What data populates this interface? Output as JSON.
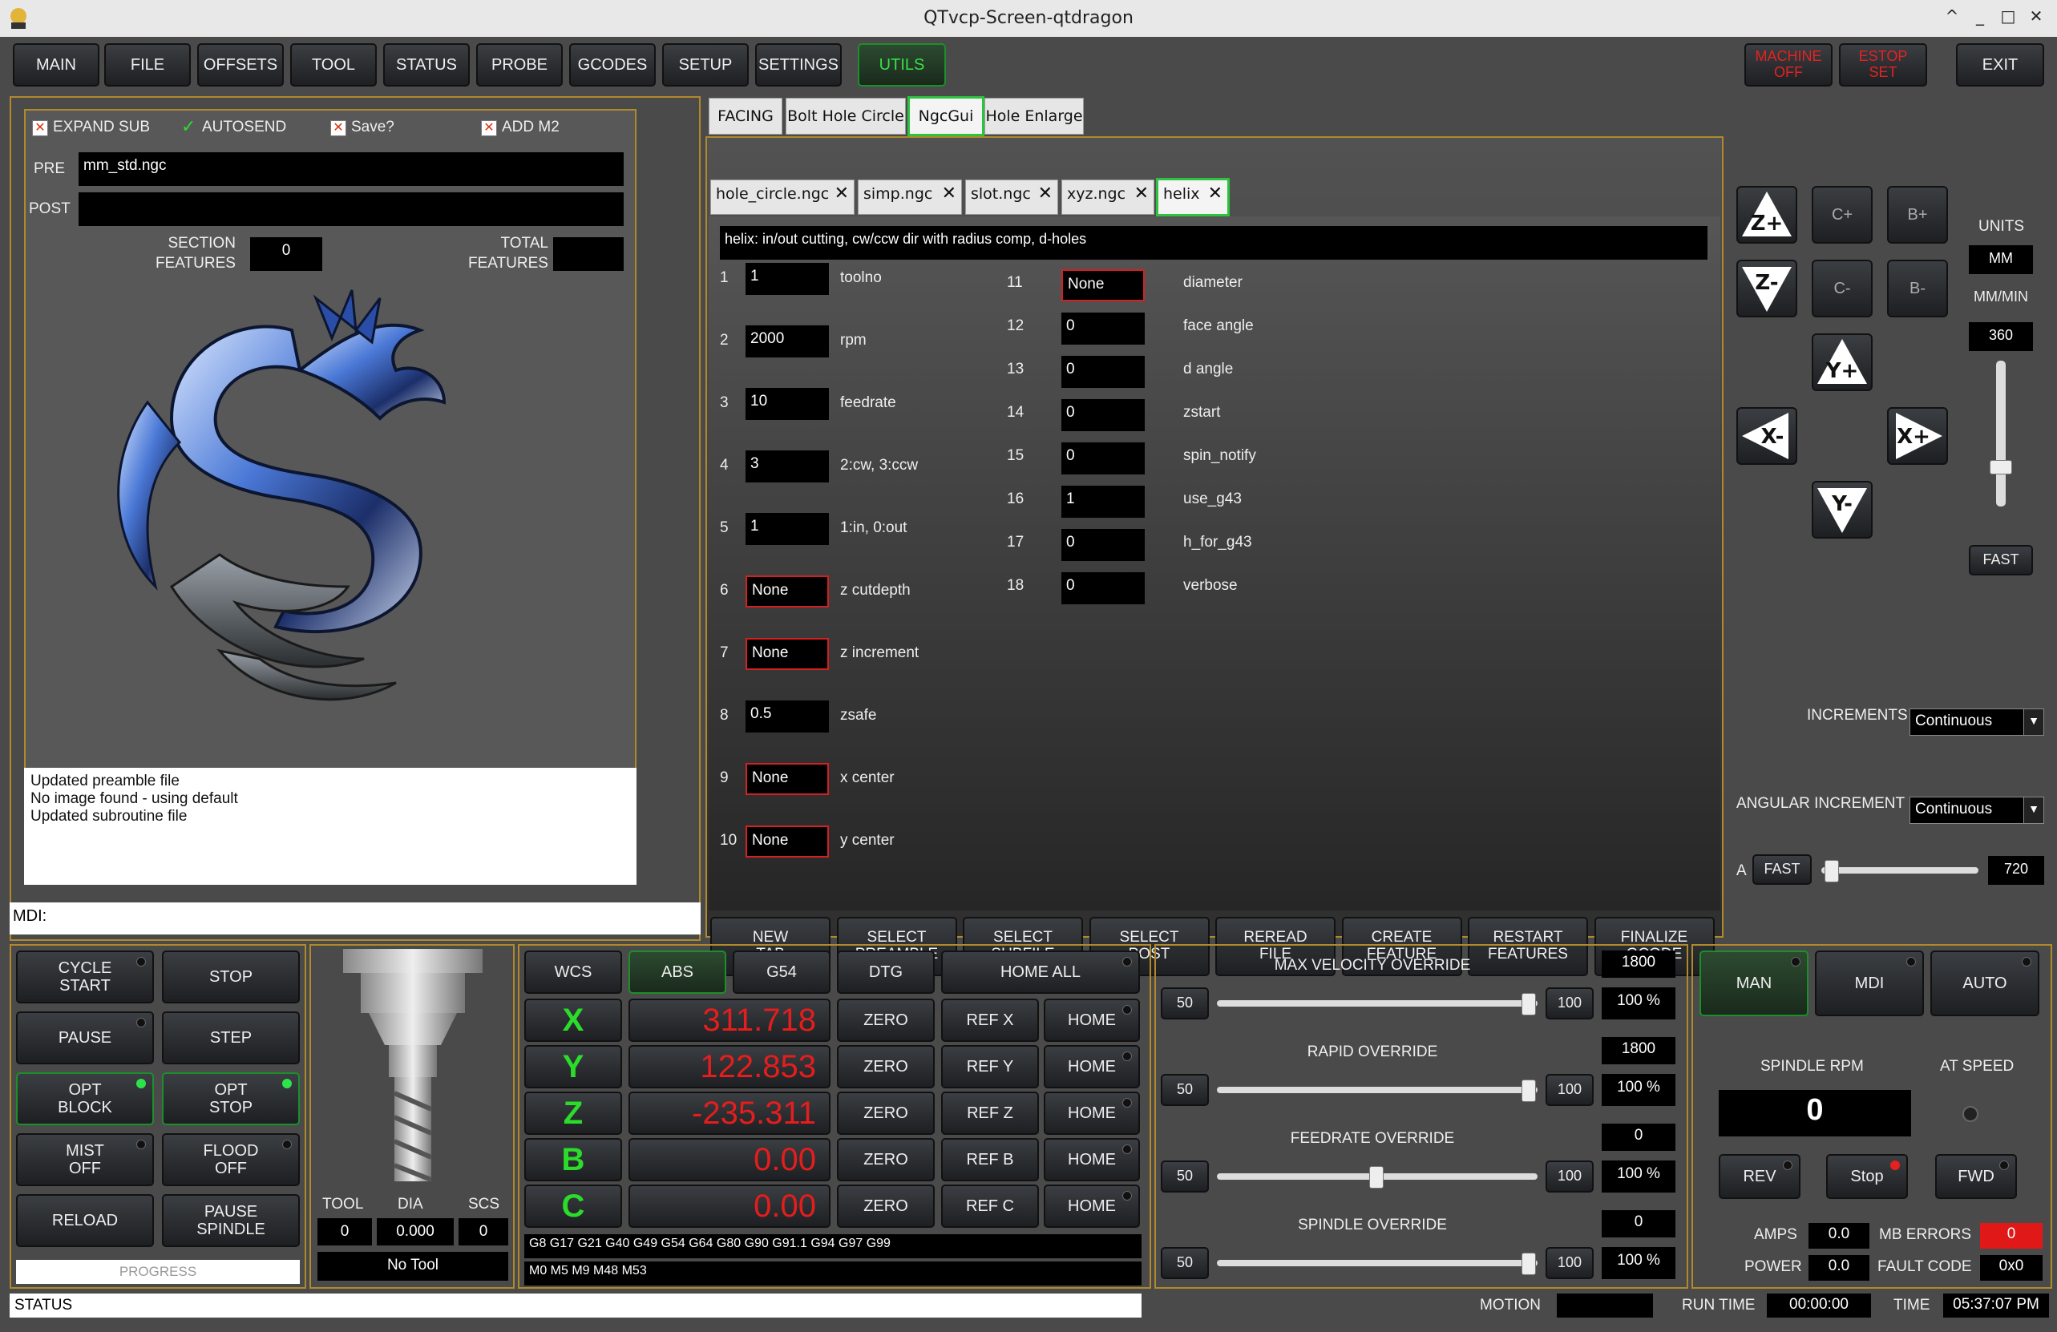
{
  "window": {
    "title": "QTvcp-Screen-qtdragon",
    "controls": [
      "^",
      "_",
      "□",
      "✕"
    ]
  },
  "topbar": {
    "tabs": [
      "MAIN",
      "FILE",
      "OFFSETS",
      "TOOL",
      "STATUS",
      "PROBE",
      "GCODES",
      "SETUP",
      "SETTINGS",
      "UTILS"
    ],
    "active_tab": "UTILS",
    "machine": "MACHINE\nOFF",
    "estop": "ESTOP\nSET",
    "exit": "EXIT"
  },
  "ngc_panel": {
    "expand_sub": "EXPAND SUB",
    "autosend": "AUTOSEND",
    "save": "Save?",
    "add_m2": "ADD M2",
    "pre_label": "PRE",
    "pre_value": "mm_std.ngc",
    "post_label": "POST",
    "post_value": "",
    "section_features_label": "SECTION\nFEATURES",
    "section_features_value": "0",
    "total_features_label": "TOTAL\nFEATURES",
    "total_features_value": "",
    "log": [
      "Updated preamble file",
      "No image found - using default",
      "Updated subroutine file"
    ],
    "mdi_label": "MDI:"
  },
  "utils_tabs": [
    "FACING",
    "Bolt Hole Circle",
    "NgcGui",
    "Hole Enlarge"
  ],
  "utils_active": "NgcGui",
  "file_tabs": [
    "hole_circle.ngc",
    "simp.ngc",
    "slot.ngc",
    "xyz.ngc",
    "helix"
  ],
  "file_active": "helix",
  "helix": {
    "description": "helix: in/out cutting, cw/ccw dir with radius comp, d-holes",
    "params_left": [
      {
        "n": "1",
        "value": "1",
        "label": "toolno",
        "invalid": false
      },
      {
        "n": "2",
        "value": "2000",
        "label": "rpm",
        "invalid": false
      },
      {
        "n": "3",
        "value": "10",
        "label": "feedrate",
        "invalid": false
      },
      {
        "n": "4",
        "value": "3",
        "label": "2:cw, 3:ccw",
        "invalid": false
      },
      {
        "n": "5",
        "value": "1",
        "label": "1:in, 0:out",
        "invalid": false
      },
      {
        "n": "6",
        "value": "None",
        "label": "z cutdepth",
        "invalid": true
      },
      {
        "n": "7",
        "value": "None",
        "label": "z increment",
        "invalid": true
      },
      {
        "n": "8",
        "value": "0.5",
        "label": "zsafe",
        "invalid": false
      },
      {
        "n": "9",
        "value": "None",
        "label": "x center",
        "invalid": true
      },
      {
        "n": "10",
        "value": "None",
        "label": "y center",
        "invalid": true
      }
    ],
    "params_right": [
      {
        "n": "11",
        "value": "None",
        "label": "diameter",
        "invalid": true
      },
      {
        "n": "12",
        "value": "0",
        "label": "face angle",
        "invalid": false
      },
      {
        "n": "13",
        "value": "0",
        "label": "d angle",
        "invalid": false
      },
      {
        "n": "14",
        "value": "0",
        "label": "zstart",
        "invalid": false
      },
      {
        "n": "15",
        "value": "0",
        "label": "spin_notify",
        "invalid": false
      },
      {
        "n": "16",
        "value": "1",
        "label": "use_g43",
        "invalid": false
      },
      {
        "n": "17",
        "value": "0",
        "label": "h_for_g43",
        "invalid": false
      },
      {
        "n": "18",
        "value": "0",
        "label": "verbose",
        "invalid": false
      }
    ]
  },
  "ngc_buttons": [
    "NEW\nTAB",
    "SELECT\nPREAMBLE",
    "SELECT\nSUBFILE",
    "SELECT\nPOST",
    "REREAD\nFILE",
    "CREATE\nFEATURE",
    "RESTART\nFEATURES",
    "FINALIZE\nGCODE"
  ],
  "jog": {
    "buttons": {
      "zplus": "Z+",
      "zminus": "Z-",
      "cplus": "C+",
      "cminus": "C-",
      "bplus": "B+",
      "bminus": "B-",
      "yplus": "Y+",
      "yminus": "Y-",
      "xminus": "X-",
      "xplus": "X+"
    },
    "units_label": "UNITS",
    "units_value": "MM",
    "rate_label": "MM/MIN",
    "rate_value": "360",
    "fast": "FAST",
    "increments_label": "INCREMENTS",
    "increments_value": "Continuous",
    "angular_label": "ANGULAR INCREMENT",
    "angular_value": "Continuous",
    "a_label": "A",
    "a_fast": "FAST",
    "a_value": "720"
  },
  "cycle": {
    "cycle_start": "CYCLE\nSTART",
    "stop": "STOP",
    "pause": "PAUSE",
    "step": "STEP",
    "opt_block": "OPT\nBLOCK",
    "opt_stop": "OPT\nSTOP",
    "mist": "MIST\nOFF",
    "flood": "FLOOD\nOFF",
    "reload": "RELOAD",
    "pause_spindle": "PAUSE\nSPINDLE",
    "progress": "PROGRESS"
  },
  "tool": {
    "tool_label": "TOOL",
    "dia_label": "DIA",
    "scs_label": "SCS",
    "tool_value": "0",
    "dia_value": "0.000",
    "scs_value": "0",
    "name": "No Tool"
  },
  "dro": {
    "wcs": "WCS",
    "abs": "ABS",
    "g54": "G54",
    "dtg": "DTG",
    "home_all": "HOME ALL",
    "axes": [
      {
        "axis": "X",
        "value": "311.718",
        "ref": "REF X"
      },
      {
        "axis": "Y",
        "value": "122.853",
        "ref": "REF Y"
      },
      {
        "axis": "Z",
        "value": "-235.311",
        "ref": "REF Z"
      },
      {
        "axis": "B",
        "value": "0.00",
        "ref": "REF B"
      },
      {
        "axis": "C",
        "value": "0.00",
        "ref": "REF C"
      }
    ],
    "zero": "ZERO",
    "home": "HOME",
    "gcodes": "G8 G17 G21 G40 G49 G54 G64 G80 G90 G91.1 G94 G97 G99",
    "mcodes": "M0 M5 M9 M48 M53"
  },
  "overrides": [
    {
      "label": "MAX VELOCITY OVERRIDE",
      "value": "1800",
      "min": "50",
      "max": "100",
      "pct": "100 %",
      "level": 1.0
    },
    {
      "label": "RAPID OVERRIDE",
      "value": "1800",
      "min": "50",
      "max": "100",
      "pct": "100 %",
      "level": 1.0
    },
    {
      "label": "FEEDRATE OVERRIDE",
      "value": "0",
      "min": "50",
      "max": "100",
      "pct": "100 %",
      "level": 0.5
    },
    {
      "label": "SPINDLE OVERRIDE",
      "value": "0",
      "min": "50",
      "max": "100",
      "pct": "100 %",
      "level": 1.0
    }
  ],
  "spindle": {
    "modes": [
      "MAN",
      "MDI",
      "AUTO"
    ],
    "rpm_label": "SPINDLE RPM",
    "rpm_value": "0",
    "at_speed": "AT SPEED",
    "rev": "REV",
    "stop": "Stop",
    "fwd": "FWD",
    "amps_label": "AMPS",
    "amps": "0.0",
    "power_label": "POWER",
    "power": "0.0",
    "mb_errors_label": "MB ERRORS",
    "mb_errors": "0",
    "fault_label": "FAULT CODE",
    "fault": "0x0"
  },
  "statusbar": {
    "status": "STATUS",
    "motion_label": "MOTION",
    "motion": "",
    "runtime_label": "RUN TIME",
    "runtime": "00:00:00",
    "time_label": "TIME",
    "time": "05:37:07 PM"
  },
  "colors": {
    "accent_green": "#2dc23f",
    "alarm_red": "#e52222",
    "frame_gold": "#b08a2a"
  }
}
